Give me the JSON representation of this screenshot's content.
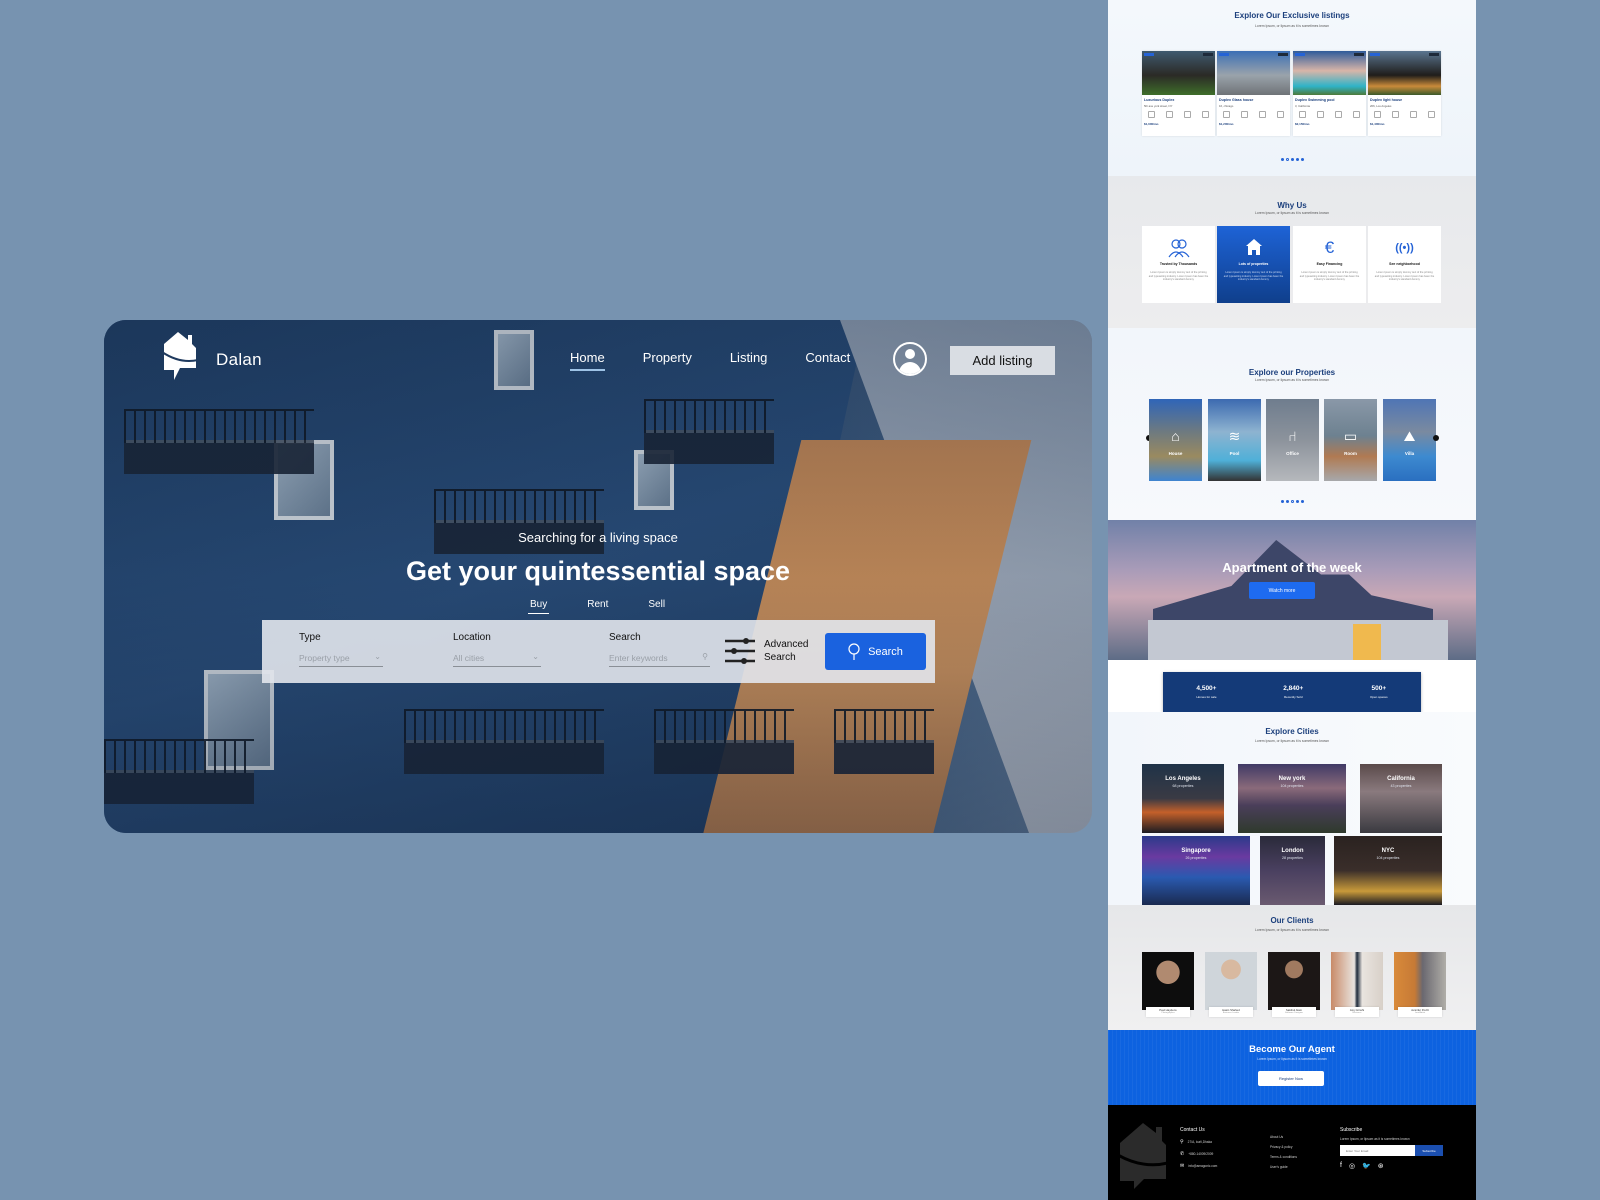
{
  "hero": {
    "brand": "Dalan",
    "nav": [
      {
        "label": "Home",
        "active": true
      },
      {
        "label": "Property",
        "active": false
      },
      {
        "label": "Listing",
        "active": false
      },
      {
        "label": "Contact",
        "active": false
      }
    ],
    "add_listing_label": "Add listing",
    "subtitle": "Searching for a living space",
    "title": "Get your quintessential space",
    "modes": [
      {
        "label": "Buy",
        "active": true
      },
      {
        "label": "Rent",
        "active": false
      },
      {
        "label": "Sell",
        "active": false
      }
    ],
    "search_bar": {
      "type_label": "Type",
      "type_placeholder": "Property type",
      "location_label": "Location",
      "location_placeholder": "All cities",
      "search_label": "Search",
      "search_placeholder": "Enter keywords",
      "advanced_line1": "Advanced",
      "advanced_line2": "Search",
      "search_button": "Search"
    }
  },
  "preview": {
    "exclusive": {
      "title": "Explore Our Exclusive listings",
      "subtitle": "Lorem Ipsum, or lipsum as it is sometimes known",
      "listings": [
        {
          "name": "Luxurious Duplex",
          "address": "5th ave york street, NY",
          "beds": "3 Beds",
          "baths": "3 Baths",
          "garage": "1 Garage",
          "area": "1100 Sqft",
          "price": "$1,000/mo",
          "tag": "Featured",
          "tag2": "For sale"
        },
        {
          "name": "Duplex Glass house",
          "address": "16, chicago",
          "beds": "4 Beds",
          "baths": "4 Baths",
          "garage": "2 Garage",
          "area": "1800 Sqft",
          "price": "$1,200/mo",
          "tag": "Featured",
          "tag2": "For sale"
        },
        {
          "name": "Duplex Swimming pool",
          "address": "3, California",
          "beds": "3 Beds",
          "baths": "3 Baths",
          "garage": "2 Garage",
          "area": "1700 Sqft",
          "price": "$2,150/mo",
          "tag": "Featured",
          "tag2": "For sale"
        },
        {
          "name": "Duplex light house",
          "address": "206, Los Angeles",
          "beds": "3 Beds",
          "baths": "3 Baths",
          "garage": "1 Garage",
          "area": "1300 Sqft",
          "price": "$1,400/mo",
          "tag": "Featured",
          "tag2": "For sale"
        }
      ]
    },
    "why_us": {
      "title": "Why Us",
      "subtitle": "Lorem Ipsum, or lipsum as it is sometimes known",
      "cards": [
        {
          "title": "Trusted by Thousands",
          "icon": "users-icon",
          "glyph": "👥",
          "text": "Lorem Ipsum is simply dummy text of the printing and typesetting industry. Lorem Ipsum has been the industry's standard dummy",
          "active": false
        },
        {
          "title": "Lots of properties",
          "icon": "home-icon",
          "glyph": "⌂",
          "text": "Lorem Ipsum is simply dummy text of the printing and typesetting industry. Lorem Ipsum has been the industry's standard dummy",
          "active": true
        },
        {
          "title": "Easy Financing",
          "icon": "euro-icon",
          "glyph": "€",
          "text": "Lorem Ipsum is simply dummy text of the printing and typesetting industry. Lorem Ipsum has been the industry's standard dummy",
          "active": false
        },
        {
          "title": "See neighborhood",
          "icon": "broadcast-icon",
          "glyph": "((•))",
          "text": "Lorem Ipsum is simply dummy text of the printing and typesetting industry. Lorem Ipsum has been the industry's standard dummy",
          "active": false
        }
      ]
    },
    "properties": {
      "title": "Explore our Properties",
      "subtitle": "Lorem Ipsum, or lipsum as it is sometimes known",
      "items": [
        {
          "label": "House",
          "icon": "house-icon",
          "glyph": "⌂"
        },
        {
          "label": "Pool",
          "icon": "pool-icon",
          "glyph": "≋"
        },
        {
          "label": "Office",
          "icon": "office-chair-icon",
          "glyph": "⑁"
        },
        {
          "label": "Room",
          "icon": "bed-icon",
          "glyph": "▭"
        },
        {
          "label": "Villa",
          "icon": "villa-icon",
          "glyph": "⛰"
        }
      ]
    },
    "apartment": {
      "title": "Apartment of the week",
      "button": "Watch more"
    },
    "stats": [
      {
        "value": "4,500+",
        "label": "Homes for sale"
      },
      {
        "value": "2,840+",
        "label": "Recently Sold"
      },
      {
        "value": "500+",
        "label": "Open spaces"
      }
    ],
    "cities": {
      "title": "Explore Cities",
      "subtitle": "Lorem Ipsum, or lipsum as it is sometimes known",
      "items": [
        {
          "name": "Los Angeles",
          "count": "68 properties"
        },
        {
          "name": "New york",
          "count": "104 properties"
        },
        {
          "name": "California",
          "count": "43 properties"
        },
        {
          "name": "Singapore",
          "count": "26 properties"
        },
        {
          "name": "London",
          "count": "28 properties"
        },
        {
          "name": "NYC",
          "count": "104 properties"
        }
      ]
    },
    "clients": {
      "title": "Our Clients",
      "subtitle": "Lorem Ipsum, or lipsum as it is sometimes known",
      "items": [
        {
          "name": "Paul Haydens",
          "role": "Photographer"
        },
        {
          "name": "Hasin Shahed",
          "role": "Business Leader"
        },
        {
          "name": "Sakibul Alam",
          "role": "Software Designer"
        },
        {
          "name": "Amy Hinshi",
          "role": "Business"
        },
        {
          "name": "Jennifer Pocht",
          "role": "Lead Artist"
        }
      ]
    },
    "agent": {
      "title": "Become Our Agent",
      "subtitle": "Lorem Ipsum, or lipsum as it is sometimes known",
      "button": "Register Now"
    },
    "footer": {
      "contact_heading": "Contact Us",
      "address": "27/A, kurli,Dhaka",
      "phone": "+880-14009/2009",
      "email": "info@amagonic.com",
      "links": [
        "About Us",
        "Privacy & policy",
        "Terms & conditions",
        "User's guide"
      ],
      "subscribe_heading": "Subscribe",
      "subscribe_text": "Lorem Ipsum, or lipsum as it is sometimes known",
      "email_placeholder": "Enter Your Email",
      "subscribe_button": "Subscribe",
      "socials": [
        "facebook-icon",
        "instagram-icon",
        "twitter-icon",
        "dribbble-icon"
      ]
    }
  }
}
